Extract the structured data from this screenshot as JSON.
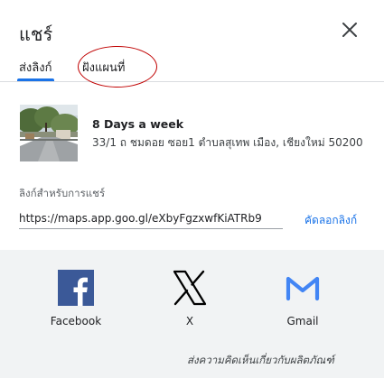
{
  "dialog": {
    "title": "แชร์",
    "close_icon": "close-icon"
  },
  "tabs": [
    {
      "label": "ส่งลิงก์",
      "active": true
    },
    {
      "label": "ฝังแผนที่",
      "active": false
    }
  ],
  "place": {
    "name": "8 Days a week",
    "address": "33/1 ถ ชมดอย ซอย1 ตำบลสุเทพ เมือง, เชียงใหม่ 50200",
    "thumbnail_icon": "street-view-photo"
  },
  "link": {
    "label": "ลิงก์สำหรับการแชร์",
    "value": "https://maps.app.goo.gl/eXbyFgzxwfKiATRb9",
    "copy_label": "คัดลอกลิงก์"
  },
  "share_targets": [
    {
      "label": "Facebook",
      "icon": "facebook-icon",
      "color": "#3b5998"
    },
    {
      "label": "X",
      "icon": "x-icon",
      "color": "#000000"
    },
    {
      "label": "Gmail",
      "icon": "gmail-icon",
      "color": "#4285f4"
    }
  ],
  "feedback": "ส่งความคิดเห็นเกี่ยวกับผลิตภัณฑ์",
  "colors": {
    "accent": "#1a73e8",
    "annotation": "#c00000",
    "footer_bg": "#f1f3f4"
  }
}
